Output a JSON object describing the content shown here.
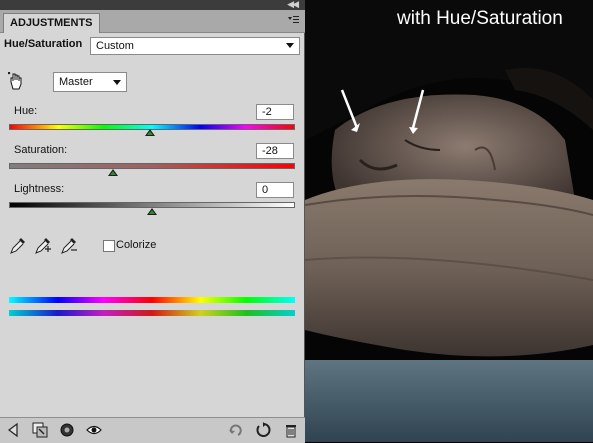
{
  "panel": {
    "tab_title": "ADJUSTMENTS",
    "icons": {
      "collapse": "double-chevron-right-icon",
      "menu": "panel-menu-icon"
    }
  },
  "preset": {
    "label": "Hue/Saturation",
    "value": "Custom"
  },
  "channel": {
    "value": "Master"
  },
  "sliders": {
    "hue": {
      "label": "Hue:",
      "value": "-2"
    },
    "saturation": {
      "label": "Saturation:",
      "value": "-28"
    },
    "lightness": {
      "label": "Lightness:",
      "value": "0"
    }
  },
  "colorize": {
    "label": "Colorize",
    "checked": false
  },
  "toolbar": {
    "icons": [
      "back-icon",
      "clip-to-layer-icon",
      "visibility-toggle-icon",
      "view-previous-state-icon",
      "reset-icon",
      "trash-icon"
    ]
  },
  "photo": {
    "title": "with Hue/Saturation"
  }
}
